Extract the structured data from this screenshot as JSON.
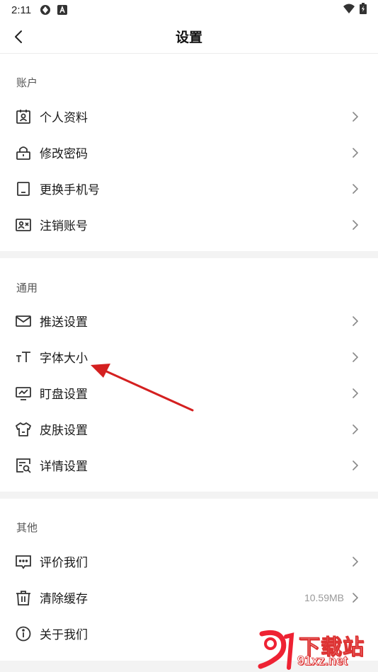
{
  "status_bar": {
    "time": "2:11"
  },
  "nav": {
    "title": "设置"
  },
  "sections": [
    {
      "header": "账户",
      "items": [
        {
          "label": "个人资料",
          "icon": "id-card-icon"
        },
        {
          "label": "修改密码",
          "icon": "lock-icon"
        },
        {
          "label": "更换手机号",
          "icon": "phone-icon"
        },
        {
          "label": "注销账号",
          "icon": "account-cancel-icon"
        }
      ]
    },
    {
      "header": "通用",
      "items": [
        {
          "label": "推送设置",
          "icon": "mail-icon"
        },
        {
          "label": "字体大小",
          "icon": "font-size-icon"
        },
        {
          "label": "盯盘设置",
          "icon": "monitor-chart-icon"
        },
        {
          "label": "皮肤设置",
          "icon": "shirt-icon"
        },
        {
          "label": "详情设置",
          "icon": "detail-search-icon"
        }
      ]
    },
    {
      "header": "其他",
      "items": [
        {
          "label": "评价我们",
          "icon": "comment-icon"
        },
        {
          "label": "清除缓存",
          "icon": "trash-icon",
          "value": "10.59MB"
        },
        {
          "label": "关于我们",
          "icon": "info-icon"
        }
      ]
    }
  ],
  "watermark": {
    "brand": "下载站",
    "url": "91xz.net"
  },
  "colors": {
    "annotation_arrow": "#d42020",
    "section_gap": "#f3f3f3",
    "icon_stroke": "#333333",
    "chevron": "#888888"
  }
}
